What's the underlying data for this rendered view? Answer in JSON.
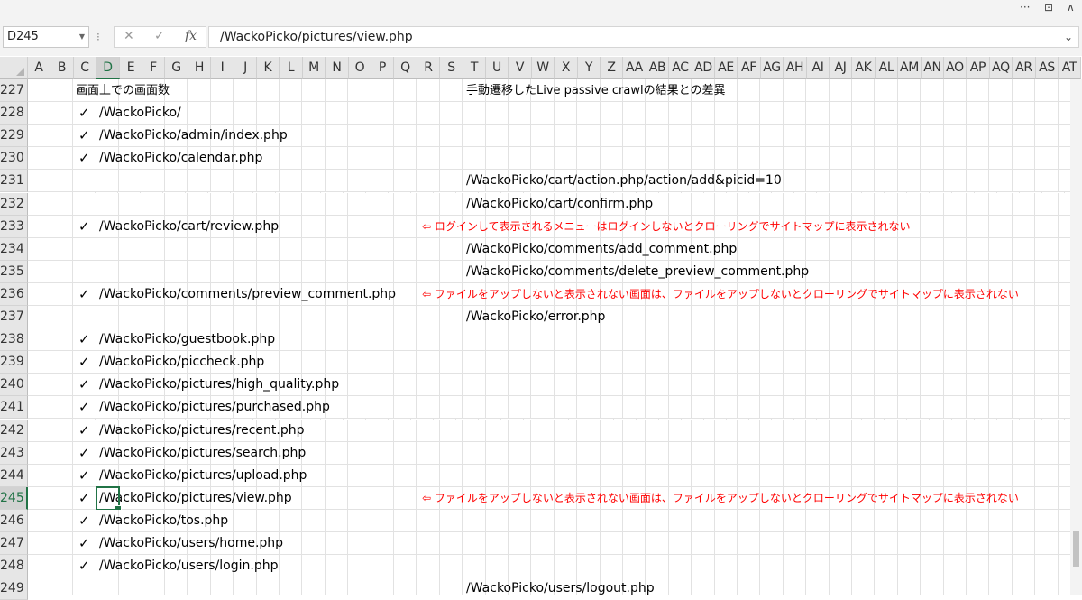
{
  "window": {
    "more_label": "···",
    "restore_label": "⊡",
    "close_label": "∧"
  },
  "formula_bar": {
    "name_box": "D245",
    "cancel_icon": "✕",
    "enter_icon": "✓",
    "fx_label": "fx",
    "value": "/WackoPicko/pictures/view.php"
  },
  "columns": [
    "A",
    "B",
    "C",
    "D",
    "E",
    "F",
    "G",
    "H",
    "I",
    "J",
    "K",
    "L",
    "M",
    "N",
    "O",
    "P",
    "Q",
    "R",
    "S",
    "T",
    "U",
    "V",
    "W",
    "X",
    "Y",
    "Z",
    "AA",
    "AB",
    "AC",
    "AD",
    "AE",
    "AF",
    "AG",
    "AH",
    "AI",
    "AJ",
    "AK",
    "AL",
    "AM",
    "AN",
    "AO",
    "AP",
    "AQ",
    "AR",
    "AS",
    "AT"
  ],
  "selected_column": "D",
  "selected_row": "245",
  "rows": [
    {
      "num": "227",
      "check": "",
      "path": "",
      "note": "",
      "right": "",
      "header_left": "画面上での画面数",
      "header_right": "手動遷移したLive passive crawlの結果との差異"
    },
    {
      "num": "228",
      "check": "✓",
      "path": "/WackoPicko/",
      "note": "",
      "right": ""
    },
    {
      "num": "229",
      "check": "✓",
      "path": "/WackoPicko/admin/index.php",
      "note": "",
      "right": ""
    },
    {
      "num": "230",
      "check": "✓",
      "path": "/WackoPicko/calendar.php",
      "note": "",
      "right": ""
    },
    {
      "num": "231",
      "check": "",
      "path": "",
      "note": "",
      "right": "/WackoPicko/cart/action.php/action/add&picid=10"
    },
    {
      "num": "232",
      "check": "",
      "path": "",
      "note": "",
      "right": "/WackoPicko/cart/confirm.php"
    },
    {
      "num": "233",
      "check": "✓",
      "path": "/WackoPicko/cart/review.php",
      "note": "⇦  ログインして表示されるメニューはログインしないとクローリングでサイトマップに表示されない",
      "right": ""
    },
    {
      "num": "234",
      "check": "",
      "path": "",
      "note": "",
      "right": "/WackoPicko/comments/add_comment.php"
    },
    {
      "num": "235",
      "check": "",
      "path": "",
      "note": "",
      "right": "/WackoPicko/comments/delete_preview_comment.php"
    },
    {
      "num": "236",
      "check": "✓",
      "path": "/WackoPicko/comments/preview_comment.php",
      "note": "⇦  ファイルをアップしないと表示されない画面は、ファイルをアップしないとクローリングでサイトマップに表示されない",
      "right": ""
    },
    {
      "num": "237",
      "check": "",
      "path": "",
      "note": "",
      "right": "/WackoPicko/error.php"
    },
    {
      "num": "238",
      "check": "✓",
      "path": "/WackoPicko/guestbook.php",
      "note": "",
      "right": ""
    },
    {
      "num": "239",
      "check": "✓",
      "path": "/WackoPicko/piccheck.php",
      "note": "",
      "right": ""
    },
    {
      "num": "240",
      "check": "✓",
      "path": "/WackoPicko/pictures/high_quality.php",
      "note": "",
      "right": ""
    },
    {
      "num": "241",
      "check": "✓",
      "path": "/WackoPicko/pictures/purchased.php",
      "note": "",
      "right": ""
    },
    {
      "num": "242",
      "check": "✓",
      "path": "/WackoPicko/pictures/recent.php",
      "note": "",
      "right": ""
    },
    {
      "num": "243",
      "check": "✓",
      "path": "/WackoPicko/pictures/search.php",
      "note": "",
      "right": ""
    },
    {
      "num": "244",
      "check": "✓",
      "path": "/WackoPicko/pictures/upload.php",
      "note": "",
      "right": ""
    },
    {
      "num": "245",
      "check": "✓",
      "path": "/WackoPicko/pictures/view.php",
      "note": "⇦  ファイルをアップしないと表示されない画面は、ファイルをアップしないとクローリングでサイトマップに表示されない",
      "right": ""
    },
    {
      "num": "246",
      "check": "✓",
      "path": "/WackoPicko/tos.php",
      "note": "",
      "right": ""
    },
    {
      "num": "247",
      "check": "✓",
      "path": "/WackoPicko/users/home.php",
      "note": "",
      "right": ""
    },
    {
      "num": "248",
      "check": "✓",
      "path": "/WackoPicko/users/login.php",
      "note": "",
      "right": ""
    },
    {
      "num": "249",
      "check": "",
      "path": "",
      "note": "",
      "right": "/WackoPicko/users/logout.php"
    }
  ]
}
